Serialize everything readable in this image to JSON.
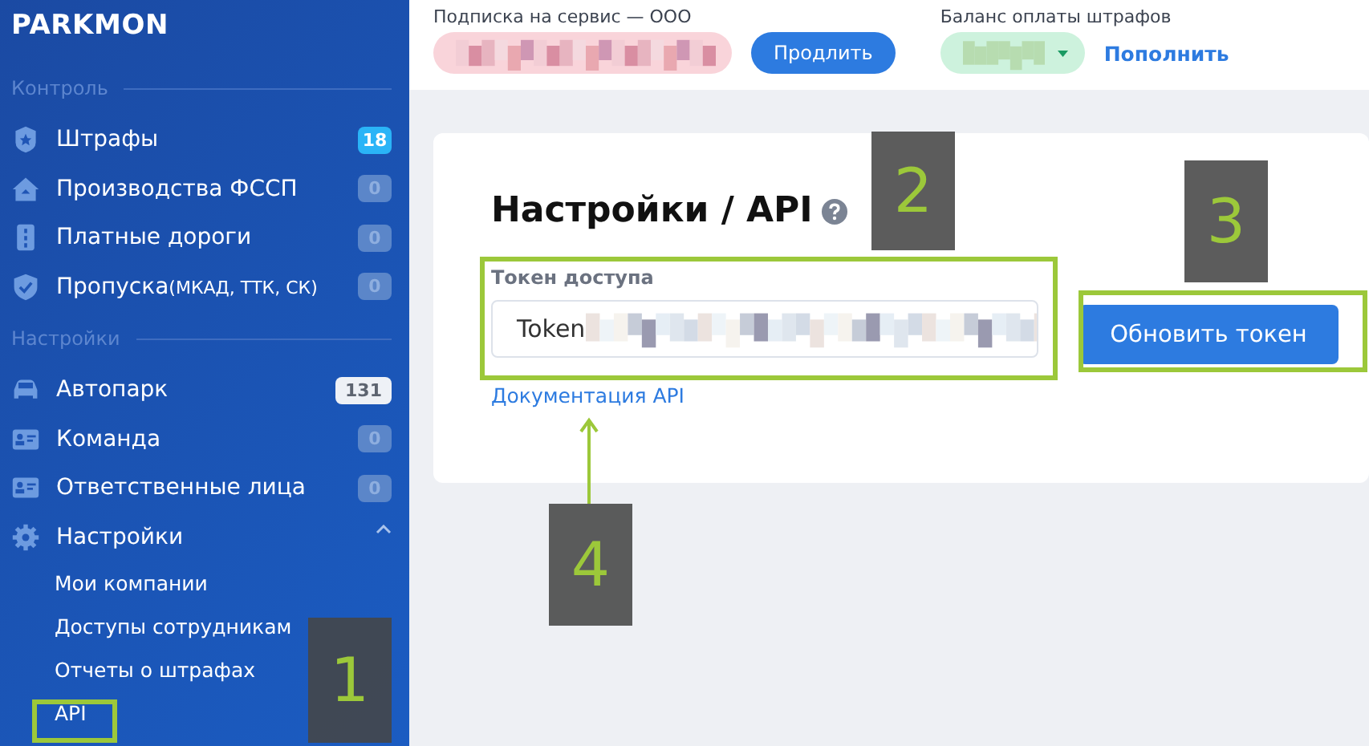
{
  "sidebar": {
    "logo": "PARKMON",
    "sections": [
      {
        "title": "Контроль",
        "items": [
          {
            "label": "Штрафы",
            "count": "18",
            "highlighted": true,
            "muted": false
          },
          {
            "label": "Производства ФССП",
            "count": "0",
            "highlighted": false,
            "muted": true
          },
          {
            "label": "Платные дороги",
            "count": "0",
            "highlighted": false,
            "muted": true
          },
          {
            "label": "Пропуска",
            "suffix": "(МКАД, ТТК, СК)",
            "count": "0",
            "highlighted": false,
            "muted": true
          }
        ]
      },
      {
        "title": "Настройки",
        "items": [
          {
            "label": "Автопарк",
            "count": "131",
            "highlighted": false,
            "muted": false
          },
          {
            "label": "Команда",
            "count": "0",
            "highlighted": false,
            "muted": true
          },
          {
            "label": "Ответственные лица",
            "count": "0",
            "highlighted": false,
            "muted": true
          },
          {
            "label": "Настройки",
            "expanded": true,
            "children": [
              {
                "label": "Мои компании"
              },
              {
                "label": "Доступы сотрудникам"
              },
              {
                "label": "Отчеты о штрафах"
              },
              {
                "label": "API"
              }
            ]
          }
        ]
      }
    ]
  },
  "top_bar": {
    "subscription": {
      "label": "Подписка на сервис — ООО",
      "button": "Продлить"
    },
    "balance": {
      "label": "Баланс оплаты штрафов",
      "link": "Пополнить"
    }
  },
  "card": {
    "title": "Настройки / API",
    "token": {
      "label": "Токен доступа",
      "value": "Token"
    },
    "link": "Документация API",
    "button": "Обновить токен"
  },
  "annotations": [
    {
      "number": "1"
    },
    {
      "number": "2"
    },
    {
      "number": "3"
    },
    {
      "number": "4"
    }
  ]
}
